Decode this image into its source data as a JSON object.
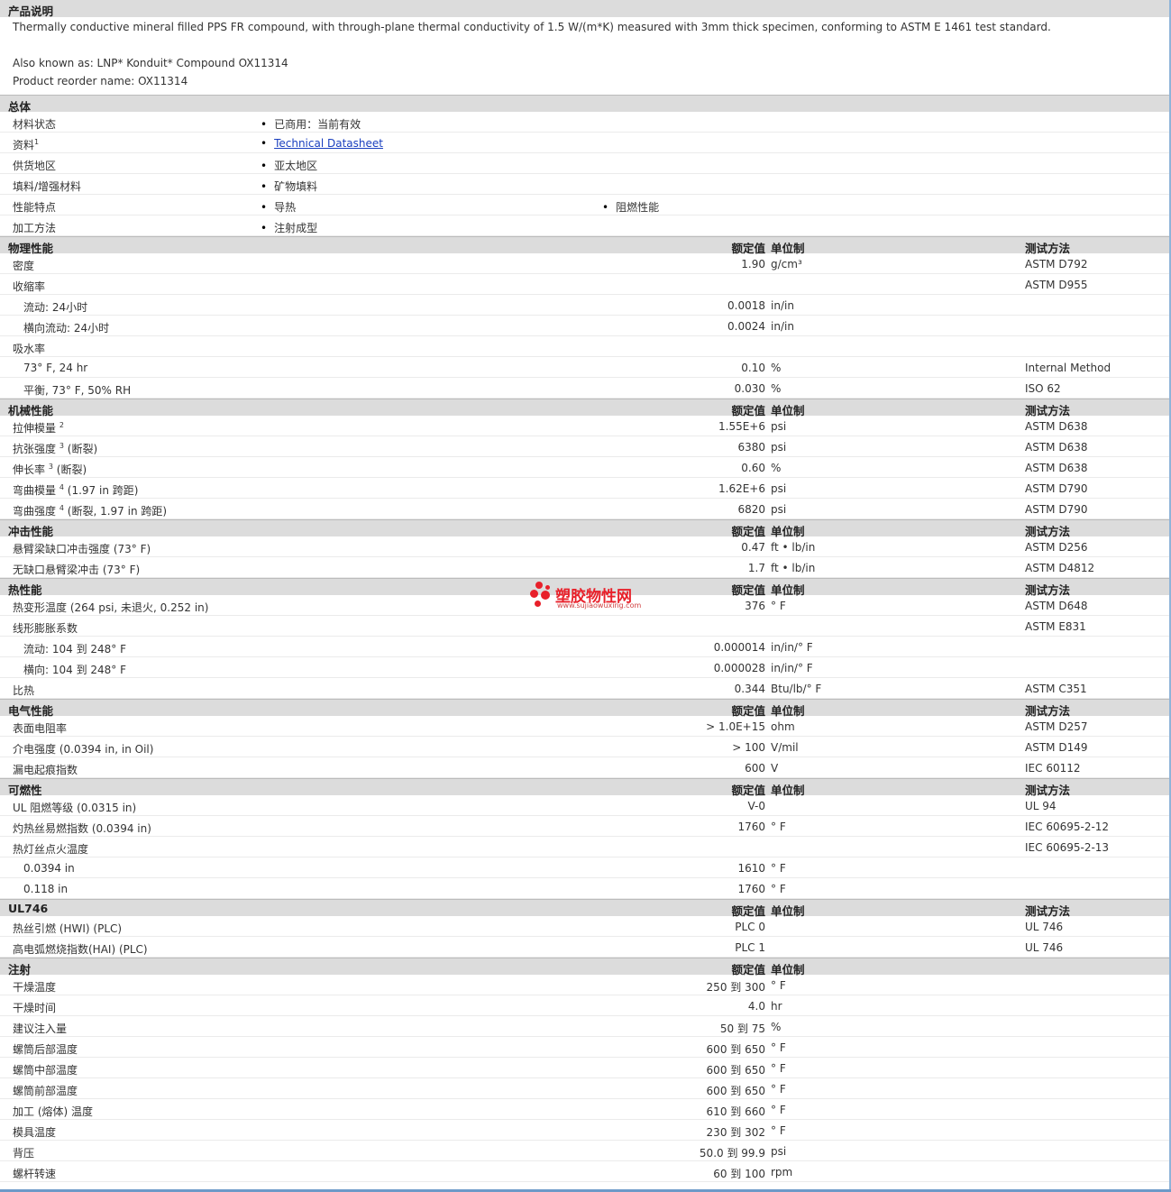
{
  "description": {
    "title": "产品说明",
    "text": "Thermally conductive mineral filled PPS FR compound, with through-plane thermal conductivity of 1.5 W/(m*K) measured with 3mm thick specimen, conforming to ASTM E 1461 test standard.",
    "aka": "Also known as: LNP* Konduit* Compound OX11314",
    "reorder": "Product reorder name: OX11314"
  },
  "general": {
    "title": "总体",
    "rows": [
      {
        "name": "材料状态",
        "v1": "已商用：当前有效"
      },
      {
        "name": "资料",
        "sup": "1",
        "link": "Technical Datasheet"
      },
      {
        "name": "供货地区",
        "v1": "亚太地区"
      },
      {
        "name": "填料/增强材料",
        "v1": "矿物填料"
      },
      {
        "name": "性能特点",
        "v1": "导热",
        "v2": "阻燃性能"
      },
      {
        "name": "加工方法",
        "v1": "注射成型"
      }
    ]
  },
  "headers": {
    "value": "额定值",
    "unit": "单位制",
    "method": "测试方法"
  },
  "sections": [
    {
      "id": "physical",
      "title": "物理性能",
      "rows": [
        {
          "name": "密度",
          "value": "1.90",
          "unit": "g/cm³",
          "method": "ASTM D792"
        },
        {
          "name": "收缩率",
          "value": "",
          "unit": "",
          "method": "ASTM D955"
        },
        {
          "name": "流动: 24小时",
          "indent": true,
          "value": "0.0018",
          "unit": "in/in",
          "method": ""
        },
        {
          "name": "横向流动: 24小时",
          "indent": true,
          "value": "0.0024",
          "unit": "in/in",
          "method": ""
        },
        {
          "name": "吸水率",
          "value": "",
          "unit": "",
          "method": ""
        },
        {
          "name": "73° F, 24 hr",
          "indent": true,
          "value": "0.10",
          "unit": "%",
          "method": "Internal Method"
        },
        {
          "name": "平衡, 73° F, 50% RH",
          "indent": true,
          "value": "0.030",
          "unit": "%",
          "method": "ISO 62"
        }
      ]
    },
    {
      "id": "mechanical",
      "title": "机械性能",
      "rows": [
        {
          "name": "拉伸模量",
          "sup": "2",
          "after": "",
          "value": "1.55E+6",
          "unit": "psi",
          "method": "ASTM D638"
        },
        {
          "name": "抗张强度",
          "sup": "3",
          "after": "(断裂)",
          "value": "6380",
          "unit": "psi",
          "method": "ASTM D638"
        },
        {
          "name": "伸长率",
          "sup": "3",
          "after": "(断裂)",
          "value": "0.60",
          "unit": "%",
          "method": "ASTM D638"
        },
        {
          "name": "弯曲模量",
          "sup": "4",
          "after": "(1.97 in 跨距)",
          "value": "1.62E+6",
          "unit": "psi",
          "method": "ASTM D790"
        },
        {
          "name": "弯曲强度",
          "sup": "4",
          "after": "(断裂, 1.97 in 跨距)",
          "value": "6820",
          "unit": "psi",
          "method": "ASTM D790"
        }
      ]
    },
    {
      "id": "impact",
      "title": "冲击性能",
      "rows": [
        {
          "name": "悬臂梁缺口冲击强度 (73° F)",
          "value": "0.47",
          "unit": "ft • lb/in",
          "method": "ASTM D256"
        },
        {
          "name": "无缺口悬臂梁冲击 (73° F)",
          "value": "1.7",
          "unit": "ft • lb/in",
          "method": "ASTM D4812"
        }
      ]
    },
    {
      "id": "thermal",
      "title": "热性能",
      "rows": [
        {
          "name": "热变形温度 (264 psi, 未退火, 0.252 in)",
          "value": "376",
          "unit": "° F",
          "method": "ASTM D648"
        },
        {
          "name": "线形膨胀系数",
          "value": "",
          "unit": "",
          "method": "ASTM E831"
        },
        {
          "name": "流动: 104 到 248° F",
          "indent": true,
          "value": "0.000014",
          "unit": "in/in/° F",
          "method": ""
        },
        {
          "name": "横向: 104 到 248° F",
          "indent": true,
          "value": "0.000028",
          "unit": "in/in/° F",
          "method": ""
        },
        {
          "name": "比热",
          "value": "0.344",
          "unit": "Btu/lb/° F",
          "method": "ASTM C351"
        }
      ]
    },
    {
      "id": "electrical",
      "title": "电气性能",
      "rows": [
        {
          "name": "表面电阻率",
          "value": "> 1.0E+15",
          "unit": "ohm",
          "method": "ASTM D257"
        },
        {
          "name": "介电强度 (0.0394 in, in Oil)",
          "value": "> 100",
          "unit": "V/mil",
          "method": "ASTM D149"
        },
        {
          "name": "漏电起痕指数",
          "value": "600",
          "unit": "V",
          "method": "IEC 60112"
        }
      ]
    },
    {
      "id": "flammability",
      "title": "可燃性",
      "rows": [
        {
          "name": "UL 阻燃等级 (0.0315 in)",
          "value": "V-0",
          "unit": "",
          "method": "UL 94"
        },
        {
          "name": "灼热丝易燃指数 (0.0394 in)",
          "value": "1760",
          "unit": "° F",
          "method": "IEC 60695-2-12"
        },
        {
          "name": "热灯丝点火温度",
          "value": "",
          "unit": "",
          "method": "IEC 60695-2-13"
        },
        {
          "name": "0.0394 in",
          "indent": true,
          "value": "1610",
          "unit": "° F",
          "method": ""
        },
        {
          "name": "0.118 in",
          "indent": true,
          "value": "1760",
          "unit": "° F",
          "method": ""
        }
      ]
    },
    {
      "id": "ul746",
      "title": "UL746",
      "rows": [
        {
          "name": "热丝引燃 (HWI) (PLC)",
          "value": "PLC 0",
          "unit": "",
          "method": "UL 746"
        },
        {
          "name": "高电弧燃烧指数(HAI) (PLC)",
          "value": "PLC 1",
          "unit": "",
          "method": "UL 746"
        }
      ]
    },
    {
      "id": "injection",
      "title": "注射",
      "nomethod": true,
      "rows": [
        {
          "name": "干燥温度",
          "value": "250 到 300",
          "unit": "° F",
          "method": ""
        },
        {
          "name": "干燥时间",
          "value": "4.0",
          "unit": "hr",
          "method": ""
        },
        {
          "name": "建议注入量",
          "value": "50 到 75",
          "unit": "%",
          "method": ""
        },
        {
          "name": "螺筒后部温度",
          "value": "600 到 650",
          "unit": "° F",
          "method": ""
        },
        {
          "name": "螺筒中部温度",
          "value": "600 到 650",
          "unit": "° F",
          "method": ""
        },
        {
          "name": "螺筒前部温度",
          "value": "600 到 650",
          "unit": "° F",
          "method": ""
        },
        {
          "name": "加工 (熔体) 温度",
          "value": "610 到 660",
          "unit": "° F",
          "method": ""
        },
        {
          "name": "模具温度",
          "value": "230 到 302",
          "unit": "° F",
          "method": ""
        },
        {
          "name": "背压",
          "value": "50.0 到 99.9",
          "unit": "psi",
          "method": ""
        },
        {
          "name": "螺杆转速",
          "value": "60 到 100",
          "unit": "rpm",
          "method": ""
        }
      ]
    }
  ],
  "watermark": {
    "name": "塑胶物性网",
    "url": "www.sujiaowuxing.com"
  },
  "colors": {
    "header_bg": "#dcdcdc",
    "link": "#1a3fbf",
    "watermark": "#e8202a"
  }
}
